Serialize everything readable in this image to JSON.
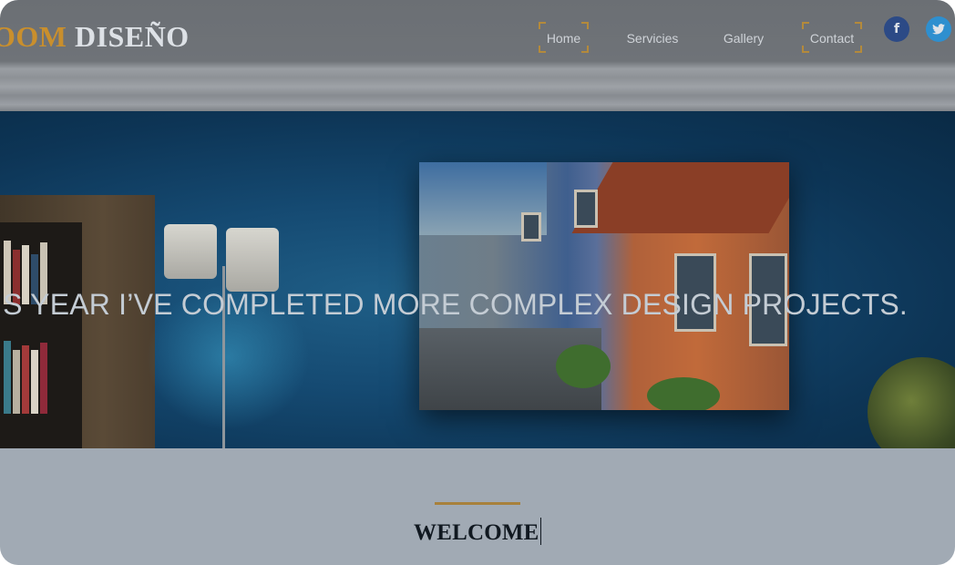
{
  "brand": {
    "logo_part1": "OOM",
    "logo_part2": "DISEÑO",
    "accent_color": "#c98f2d"
  },
  "nav": {
    "items": [
      {
        "label": "Home",
        "active": true
      },
      {
        "label": "Servicies",
        "active": false
      },
      {
        "label": "Gallery",
        "active": false
      },
      {
        "label": "Contact",
        "active": true
      }
    ]
  },
  "social": {
    "facebook_icon": "facebook-icon",
    "facebook_glyph": "f",
    "twitter_icon": "twitter-icon"
  },
  "hero": {
    "headline": "IS YEAR I’VE COMPLETED MORE COMPLEX DESIGN PROJECTS."
  },
  "welcome": {
    "title": "WELCOME"
  }
}
